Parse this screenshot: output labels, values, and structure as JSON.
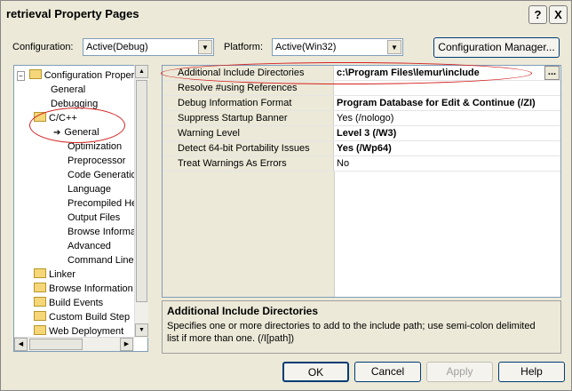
{
  "window": {
    "title": "retrieval Property Pages",
    "help_btn": "?",
    "close_btn": "X"
  },
  "config": {
    "configuration_label": "Configuration:",
    "configuration_value": "Active(Debug)",
    "platform_label": "Platform:",
    "platform_value": "Active(Win32)",
    "manager_button": "Configuration Manager..."
  },
  "tree": {
    "items": [
      {
        "label": "Configuration Propertie"
      },
      {
        "label": "General"
      },
      {
        "label": "Debugging"
      },
      {
        "label": "C/C++"
      },
      {
        "label": "General"
      },
      {
        "label": "Optimization"
      },
      {
        "label": "Preprocessor"
      },
      {
        "label": "Code Generatio"
      },
      {
        "label": "Language"
      },
      {
        "label": "Precompiled He"
      },
      {
        "label": "Output Files"
      },
      {
        "label": "Browse Informa"
      },
      {
        "label": "Advanced"
      },
      {
        "label": "Command Line"
      },
      {
        "label": "Linker"
      },
      {
        "label": "Browse Information"
      },
      {
        "label": "Build Events"
      },
      {
        "label": "Custom Build Step"
      },
      {
        "label": "Web Deployment"
      }
    ]
  },
  "grid": {
    "rows": [
      {
        "key": "Additional Include Directories",
        "value": "c:\\Program Files\\lemur\\include"
      },
      {
        "key": "Resolve #using References",
        "value": ""
      },
      {
        "key": "Debug Information Format",
        "value": "Program Database for Edit & Continue (/ZI)"
      },
      {
        "key": "Suppress Startup Banner",
        "value": "Yes (/nologo)"
      },
      {
        "key": "Warning Level",
        "value": "Level 3 (/W3)"
      },
      {
        "key": "Detect 64-bit Portability Issues",
        "value": "Yes (/Wp64)"
      },
      {
        "key": "Treat Warnings As Errors",
        "value": "No"
      }
    ],
    "ellipsis_btn": "..."
  },
  "description": {
    "title": "Additional Include Directories",
    "text": "Specifies one or more directories to add to the include path; use semi-colon delimited list if more than one.     (/I[path])"
  },
  "buttons": {
    "ok": "OK",
    "cancel": "Cancel",
    "apply": "Apply",
    "help": "Help"
  },
  "colors": {
    "annotation": "#d42020",
    "panel": "#ece9d8"
  }
}
